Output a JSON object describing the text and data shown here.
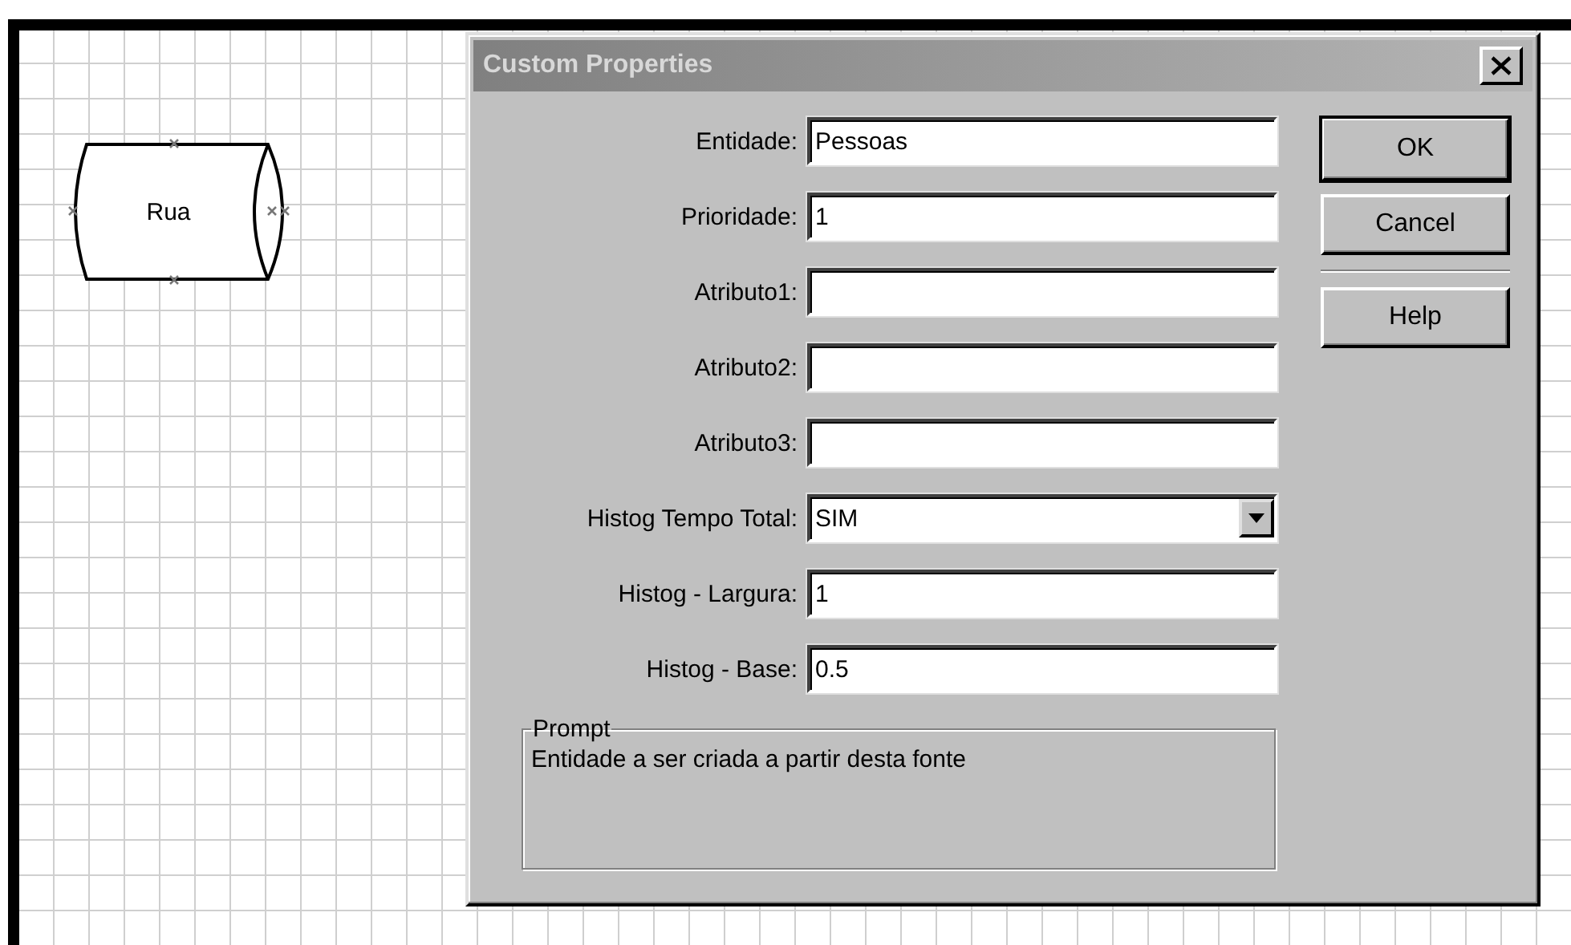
{
  "canvas": {
    "shape": {
      "label": "Rua"
    }
  },
  "dialog": {
    "title": "Custom Properties",
    "fields": [
      {
        "kind": "text",
        "label": "Entidade:",
        "value": "Pessoas"
      },
      {
        "kind": "text",
        "label": "Prioridade:",
        "value": "1"
      },
      {
        "kind": "text",
        "label": "Atributo1:"
      },
      {
        "kind": "text",
        "label": "Atributo2:"
      },
      {
        "kind": "text",
        "label": "Atributo3:"
      },
      {
        "kind": "select",
        "label": "Histog Tempo Total:",
        "value": "SIM"
      },
      {
        "kind": "text",
        "label": "Histog - Largura:",
        "value": "1"
      },
      {
        "kind": "text",
        "label": "Histog - Base:",
        "value": "0.5"
      }
    ],
    "buttons": [
      {
        "label": "OK",
        "default": true
      },
      {
        "label": "Cancel",
        "default": false
      },
      {
        "label": "Help",
        "default": false
      }
    ],
    "prompt": {
      "title": "Prompt",
      "text": "Entidade a ser criada a partir desta fonte"
    }
  }
}
